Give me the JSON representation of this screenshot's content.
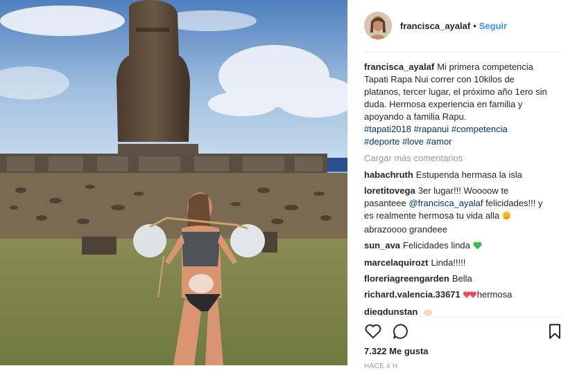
{
  "post": {
    "username": "francisca_ayalaf",
    "dot": "•",
    "follow_label": "Seguir"
  },
  "caption": {
    "username": "francisca_ayalaf",
    "text": "Mi primera competencia Tapati Rapa Nui correr con 10kilos de platanos, tercer lugar, el próximo año 1ero sin duda. Hermosa experiencia en familia y apoyando a familia Rapu.",
    "hashtags": [
      "#tapati2018",
      "#rapanui",
      "#competencia",
      "#deporte",
      "#love",
      "#amor"
    ]
  },
  "load_more_label": "Cargar más comentarios",
  "comments": [
    {
      "user": "habachruth",
      "text": "Estupenda hermasa la isla"
    },
    {
      "user": "loretitovega",
      "text_before": "3er lugar!!! Woooow te pasanteee",
      "mention": "@francisca_ayalaf",
      "text_after": "felicidades!!! y es realmente hermosa tu vida alla",
      "emoji": "heart-eyes-emoji",
      "text_end": "abrazoooo grandeee"
    },
    {
      "user": "sun_ava",
      "text": "Felicidades linda",
      "emoji": "green-heart-emoji"
    },
    {
      "user": "marcelaquirozt",
      "text": "Linda!!!!!"
    },
    {
      "user": "floreriagreengarden",
      "text": "Bella"
    },
    {
      "user": "richard.valencia.33671",
      "text": "hermosa",
      "emoji": "two-hearts-emoji"
    },
    {
      "user": "diegdunstan",
      "text": "",
      "emoji": "clapping-hands-emoji"
    }
  ],
  "likes": {
    "count": "7.322",
    "label": "Me gusta"
  },
  "timestamp": "HACE 4 H",
  "icons": {
    "like": "heart-icon",
    "comment": "comment-icon",
    "save": "bookmark-icon"
  },
  "colors": {
    "link": "#3897f0",
    "hashtag": "#003569",
    "muted": "#999999",
    "heart": "#ed4956",
    "green_heart": "#2fbf4e"
  }
}
